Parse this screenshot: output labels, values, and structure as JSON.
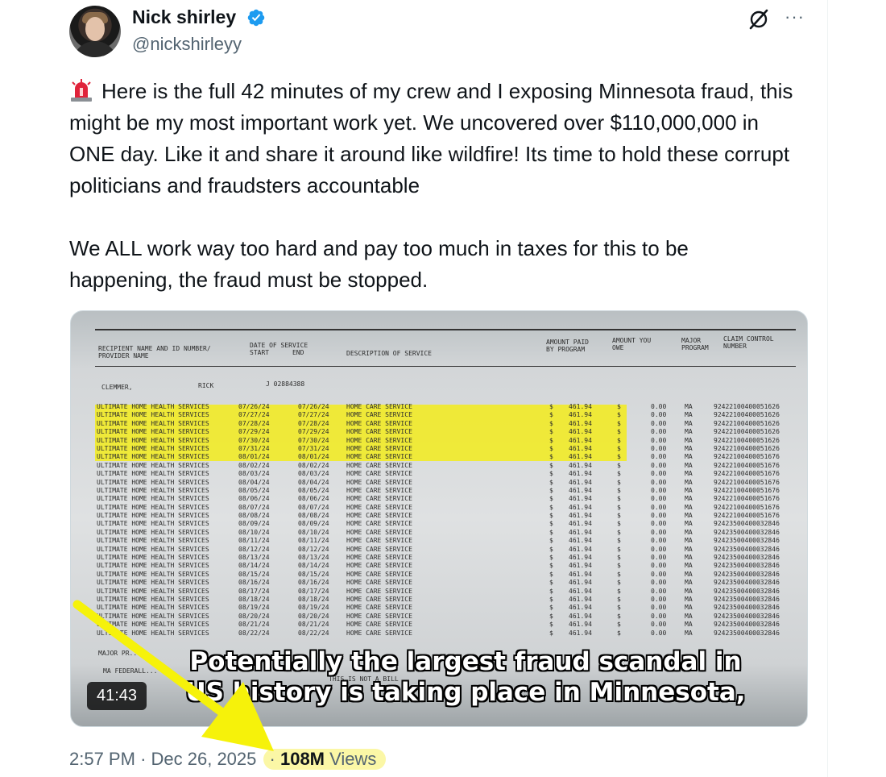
{
  "author": {
    "name": "Nick shirley",
    "handle": "@nickshirleyy",
    "verified": true
  },
  "icons": {
    "grok": "grok-icon",
    "more": "more-options-icon",
    "siren": "rotating-light-emoji",
    "verified": "verified-badge-icon",
    "arrow": "yellow-arrow-annotation"
  },
  "more_label": "···",
  "tweet": {
    "paragraph1": "Here is the full 42 minutes of my crew and I exposing Minnesota fraud, this might be my most important work yet. We uncovered over $110,000,000 in ONE day. Like it and share it around like wildfire! Its time to hold these corrupt politicians and fraudsters accountable",
    "paragraph2": "We ALL work way too hard and pay too much in taxes for this to be happening, the fraud must be stopped."
  },
  "video": {
    "duration": "41:43",
    "subtitle_line1": "Potentially the largest fraud scandal in",
    "subtitle_line2": "US history is taking place in Minnesota,",
    "doc": {
      "header_recipient": "RECIPIENT NAME AND ID NUMBER/\nPROVIDER NAME",
      "header_dates": "DATE OF SERVICE\nSTART      END",
      "header_desc": "DESCRIPTION OF SERVICE",
      "header_amount": "AMOUNT PAID\nBY PROGRAM",
      "header_amount_you": "AMOUNT YOU\nOWE",
      "header_major": "MAJOR\nPROGRAM",
      "header_claim": "CLAIM CONTROL\nNUMBER",
      "recipient_last": "CLEMMER,",
      "recipient_first": "RICK",
      "recipient_id": "J 02884388",
      "footer_major": "MAJOR PR...",
      "footer_ma": "MA FEDERALL...",
      "footer_notbill": "THIS IS NOT A BILL",
      "rows": [
        {
          "provider": "ULTIMATE HOME HEALTH SERVICES",
          "start": "07/26/24",
          "end": "07/26/24",
          "desc": "HOME CARE SERVICE",
          "paid": "461.94",
          "owe": "0.00",
          "prog": "MA",
          "claim": "92422100400051626"
        },
        {
          "provider": "ULTIMATE HOME HEALTH SERVICES",
          "start": "07/27/24",
          "end": "07/27/24",
          "desc": "HOME CARE SERVICE",
          "paid": "461.94",
          "owe": "0.00",
          "prog": "MA",
          "claim": "92422100400051626"
        },
        {
          "provider": "ULTIMATE HOME HEALTH SERVICES",
          "start": "07/28/24",
          "end": "07/28/24",
          "desc": "HOME CARE SERVICE",
          "paid": "461.94",
          "owe": "0.00",
          "prog": "MA",
          "claim": "92422100400051626"
        },
        {
          "provider": "ULTIMATE HOME HEALTH SERVICES",
          "start": "07/29/24",
          "end": "07/29/24",
          "desc": "HOME CARE SERVICE",
          "paid": "461.94",
          "owe": "0.00",
          "prog": "MA",
          "claim": "92422100400051626"
        },
        {
          "provider": "ULTIMATE HOME HEALTH SERVICES",
          "start": "07/30/24",
          "end": "07/30/24",
          "desc": "HOME CARE SERVICE",
          "paid": "461.94",
          "owe": "0.00",
          "prog": "MA",
          "claim": "92422100400051626"
        },
        {
          "provider": "ULTIMATE HOME HEALTH SERVICES",
          "start": "07/31/24",
          "end": "07/31/24",
          "desc": "HOME CARE SERVICE",
          "paid": "461.94",
          "owe": "0.00",
          "prog": "MA",
          "claim": "92422100400051626"
        },
        {
          "provider": "ULTIMATE HOME HEALTH SERVICES",
          "start": "08/01/24",
          "end": "08/01/24",
          "desc": "HOME CARE SERVICE",
          "paid": "461.94",
          "owe": "0.00",
          "prog": "MA",
          "claim": "92422100400051676"
        },
        {
          "provider": "ULTIMATE HOME HEALTH SERVICES",
          "start": "08/02/24",
          "end": "08/02/24",
          "desc": "HOME CARE SERVICE",
          "paid": "461.94",
          "owe": "0.00",
          "prog": "MA",
          "claim": "92422100400051676"
        },
        {
          "provider": "ULTIMATE HOME HEALTH SERVICES",
          "start": "08/03/24",
          "end": "08/03/24",
          "desc": "HOME CARE SERVICE",
          "paid": "461.94",
          "owe": "0.00",
          "prog": "MA",
          "claim": "92422100400051676"
        },
        {
          "provider": "ULTIMATE HOME HEALTH SERVICES",
          "start": "08/04/24",
          "end": "08/04/24",
          "desc": "HOME CARE SERVICE",
          "paid": "461.94",
          "owe": "0.00",
          "prog": "MA",
          "claim": "92422100400051676"
        },
        {
          "provider": "ULTIMATE HOME HEALTH SERVICES",
          "start": "08/05/24",
          "end": "08/05/24",
          "desc": "HOME CARE SERVICE",
          "paid": "461.94",
          "owe": "0.00",
          "prog": "MA",
          "claim": "92422100400051676"
        },
        {
          "provider": "ULTIMATE HOME HEALTH SERVICES",
          "start": "08/06/24",
          "end": "08/06/24",
          "desc": "HOME CARE SERVICE",
          "paid": "461.94",
          "owe": "0.00",
          "prog": "MA",
          "claim": "92422100400051676"
        },
        {
          "provider": "ULTIMATE HOME HEALTH SERVICES",
          "start": "08/07/24",
          "end": "08/07/24",
          "desc": "HOME CARE SERVICE",
          "paid": "461.94",
          "owe": "0.00",
          "prog": "MA",
          "claim": "92422100400051676"
        },
        {
          "provider": "ULTIMATE HOME HEALTH SERVICES",
          "start": "08/08/24",
          "end": "08/08/24",
          "desc": "HOME CARE SERVICE",
          "paid": "461.94",
          "owe": "0.00",
          "prog": "MA",
          "claim": "92422100400051676"
        },
        {
          "provider": "ULTIMATE HOME HEALTH SERVICES",
          "start": "08/09/24",
          "end": "08/09/24",
          "desc": "HOME CARE SERVICE",
          "paid": "461.94",
          "owe": "0.00",
          "prog": "MA",
          "claim": "92423500400032846"
        },
        {
          "provider": "ULTIMATE HOME HEALTH SERVICES",
          "start": "08/10/24",
          "end": "08/10/24",
          "desc": "HOME CARE SERVICE",
          "paid": "461.94",
          "owe": "0.00",
          "prog": "MA",
          "claim": "92423500400032846"
        },
        {
          "provider": "ULTIMATE HOME HEALTH SERVICES",
          "start": "08/11/24",
          "end": "08/11/24",
          "desc": "HOME CARE SERVICE",
          "paid": "461.94",
          "owe": "0.00",
          "prog": "MA",
          "claim": "92423500400032846"
        },
        {
          "provider": "ULTIMATE HOME HEALTH SERVICES",
          "start": "08/12/24",
          "end": "08/12/24",
          "desc": "HOME CARE SERVICE",
          "paid": "461.94",
          "owe": "0.00",
          "prog": "MA",
          "claim": "92423500400032846"
        },
        {
          "provider": "ULTIMATE HOME HEALTH SERVICES",
          "start": "08/13/24",
          "end": "08/13/24",
          "desc": "HOME CARE SERVICE",
          "paid": "461.94",
          "owe": "0.00",
          "prog": "MA",
          "claim": "92423500400032846"
        },
        {
          "provider": "ULTIMATE HOME HEALTH SERVICES",
          "start": "08/14/24",
          "end": "08/14/24",
          "desc": "HOME CARE SERVICE",
          "paid": "461.94",
          "owe": "0.00",
          "prog": "MA",
          "claim": "92423500400032846"
        },
        {
          "provider": "ULTIMATE HOME HEALTH SERVICES",
          "start": "08/15/24",
          "end": "08/15/24",
          "desc": "HOME CARE SERVICE",
          "paid": "461.94",
          "owe": "0.00",
          "prog": "MA",
          "claim": "92423500400032846"
        },
        {
          "provider": "ULTIMATE HOME HEALTH SERVICES",
          "start": "08/16/24",
          "end": "08/16/24",
          "desc": "HOME CARE SERVICE",
          "paid": "461.94",
          "owe": "0.00",
          "prog": "MA",
          "claim": "92423500400032846"
        },
        {
          "provider": "ULTIMATE HOME HEALTH SERVICES",
          "start": "08/17/24",
          "end": "08/17/24",
          "desc": "HOME CARE SERVICE",
          "paid": "461.94",
          "owe": "0.00",
          "prog": "MA",
          "claim": "92423500400032846"
        },
        {
          "provider": "ULTIMATE HOME HEALTH SERVICES",
          "start": "08/18/24",
          "end": "08/18/24",
          "desc": "HOME CARE SERVICE",
          "paid": "461.94",
          "owe": "0.00",
          "prog": "MA",
          "claim": "92423500400032846"
        },
        {
          "provider": "ULTIMATE HOME HEALTH SERVICES",
          "start": "08/19/24",
          "end": "08/19/24",
          "desc": "HOME CARE SERVICE",
          "paid": "461.94",
          "owe": "0.00",
          "prog": "MA",
          "claim": "92423500400032846"
        },
        {
          "provider": "ULTIMATE HOME HEALTH SERVICES",
          "start": "08/20/24",
          "end": "08/20/24",
          "desc": "HOME CARE SERVICE",
          "paid": "461.94",
          "owe": "0.00",
          "prog": "MA",
          "claim": "92423500400032846"
        },
        {
          "provider": "ULTIMATE HOME HEALTH SERVICES",
          "start": "08/21/24",
          "end": "08/21/24",
          "desc": "HOME CARE SERVICE",
          "paid": "461.94",
          "owe": "0.00",
          "prog": "MA",
          "claim": "92423500400032846"
        },
        {
          "provider": "ULTIMATE HOME HEALTH SERVICES",
          "start": "08/22/24",
          "end": "08/22/24",
          "desc": "HOME CARE SERVICE",
          "paid": "461.94",
          "owe": "0.00",
          "prog": "MA",
          "claim": "92423500400032846"
        }
      ]
    }
  },
  "meta": {
    "time": "2:57 PM",
    "separator": "·",
    "date": "Dec 26, 2025",
    "views_count": "108M",
    "views_label": "Views"
  },
  "colors": {
    "verified": "#1d9bf0",
    "highlight": "#f1ea2a",
    "arrow": "#f6f20a",
    "secondary_text": "#536471"
  }
}
